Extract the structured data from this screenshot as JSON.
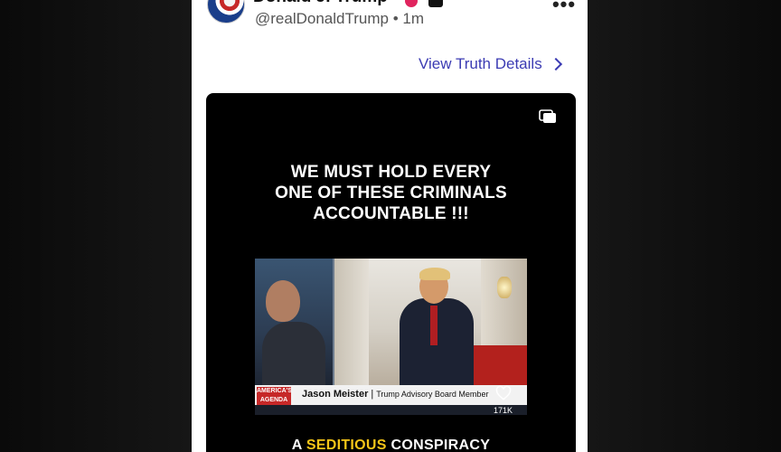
{
  "post": {
    "display_name": "Donald J. Trump",
    "handle": "@realDonaldTrump",
    "separator": "•",
    "time": "1m",
    "more_label": "•••",
    "view_details_label": "View Truth Details"
  },
  "media": {
    "headline_lines": [
      "WE MUST HOLD EVERY",
      "ONE OF THESE CRIMINALS",
      "ACCOUNTABLE !!!"
    ],
    "network_logo": "AMERICA'S AGENDA",
    "lower_third_name": "Jason Meister",
    "lower_third_role": "Trump Advisory Board Member",
    "likes": "171K",
    "caption_prefix": "A",
    "caption_highlight": "SEDITIOUS",
    "caption_suffix": "CONSPIRACY"
  },
  "colors": {
    "link": "#3b3bb3",
    "highlight": "#f5c518",
    "badge": "#e0245e"
  },
  "icons": [
    "avatar",
    "verified-badge-icon",
    "more-options-icon",
    "chevron-right-icon",
    "gallery-icon",
    "heart-icon"
  ]
}
